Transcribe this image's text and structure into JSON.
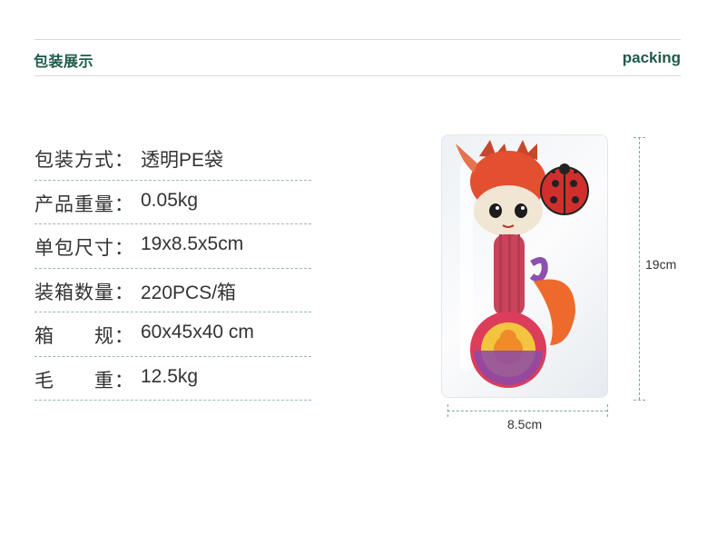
{
  "header": {
    "title_cn": "包装展示",
    "title_en": "packing"
  },
  "specs": [
    {
      "label": "包装方式：",
      "value": "透明PE袋"
    },
    {
      "label": "产品重量：",
      "value": "0.05kg"
    },
    {
      "label": "单包尺寸：",
      "value": "19x8.5x5cm"
    },
    {
      "label": "装箱数量：",
      "value": "220PCS/箱"
    },
    {
      "label": "箱　　规：",
      "value": "60x45x40 cm"
    },
    {
      "label": "毛　　重：",
      "value": "12.5kg"
    }
  ],
  "product": {
    "height_label": "19cm",
    "width_label": "8.5cm",
    "image_subject": "plush-fox-rattle-toy-in-bag"
  },
  "colors": {
    "title": "#1f5a49",
    "dash": "#9cb8b2"
  }
}
